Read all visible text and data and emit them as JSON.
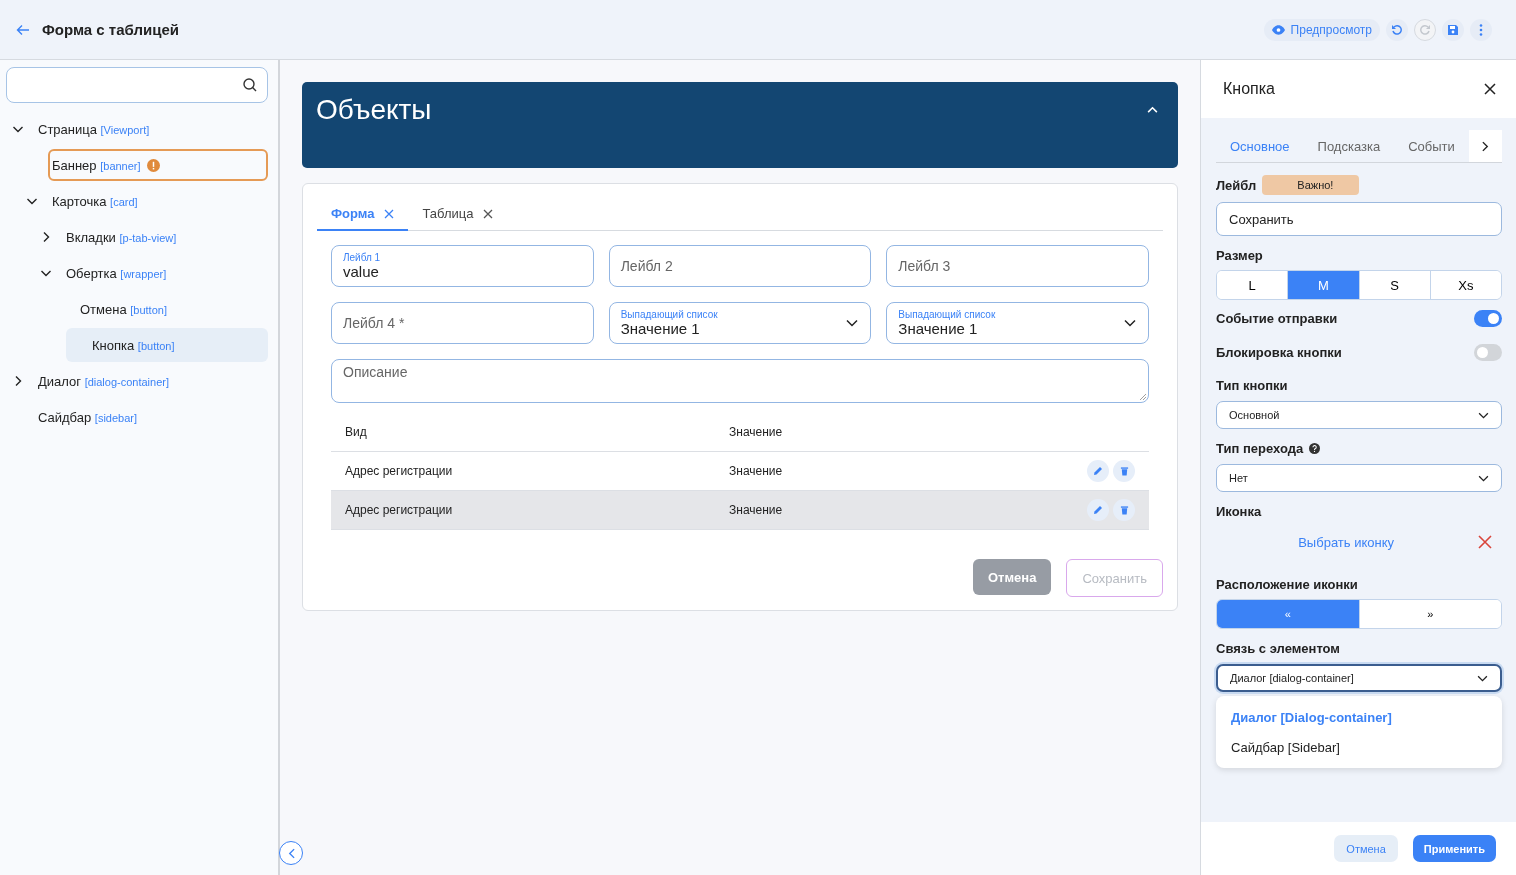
{
  "header": {
    "title": "Форма с таблицей",
    "preview": "Предпросмотр",
    "redo_disabled": true
  },
  "tree": [
    {
      "name": "Страница",
      "tag": "[Viewport]",
      "expanded": true,
      "selected": false,
      "children": [
        {
          "name": "Баннер",
          "tag": "[banner]",
          "selected": false,
          "warning": true
        },
        {
          "name": "Карточка",
          "tag": "[card]",
          "expanded": true,
          "selected": false,
          "children": [
            {
              "name": "Вкладки",
              "tag": "[p-tab-view]",
              "expanded": false,
              "selected": false
            },
            {
              "name": "Обертка",
              "tag": "[wrapper]",
              "expanded": true,
              "selected": false,
              "children": [
                {
                  "name": "Отмена",
                  "tag": "[button]",
                  "selected": false
                },
                {
                  "name": "Кнопка",
                  "tag": "[button]",
                  "selected": true
                }
              ]
            }
          ]
        }
      ]
    },
    {
      "name": "Диалог",
      "tag": "[dialog-container]",
      "expanded": false,
      "selected": false
    },
    {
      "name": "Сайдбар",
      "tag": "[sidebar]",
      "selected": false
    }
  ],
  "banner": {
    "title": "Объекты",
    "expanded": true
  },
  "card": {
    "tabs": [
      {
        "label": "Форма",
        "selected": true
      },
      {
        "label": "Таблица",
        "selected": false
      }
    ],
    "fields": [
      {
        "kind": "text",
        "label": "Лейбл 1",
        "value": "value"
      },
      {
        "kind": "text",
        "placeholder": "Лейбл 2"
      },
      {
        "kind": "text",
        "placeholder": "Лейбл 3"
      },
      {
        "kind": "text",
        "placeholder": "Лейбл 4 *"
      },
      {
        "kind": "select",
        "label": "Выпадающий список",
        "value": "Значение 1"
      },
      {
        "kind": "select",
        "label": "Выпадающий список",
        "value": "Значение 1"
      },
      {
        "kind": "textarea",
        "placeholder": "Описание"
      }
    ],
    "table": {
      "columns": [
        "Вид",
        "Значение"
      ],
      "rows": [
        {
          "cells": [
            "Адрес регистрации",
            "Значение"
          ],
          "hovered": false
        },
        {
          "cells": [
            "Адрес регистрации",
            "Значение"
          ],
          "hovered": true
        }
      ]
    },
    "cancel": "Отмена",
    "save": {
      "label": "Сохранить",
      "disabled": true
    }
  },
  "panel": {
    "title": "Кнопка",
    "tabs": [
      {
        "label": "Основное",
        "selected": true
      },
      {
        "label": "Подсказка",
        "selected": false
      },
      {
        "label": "Событи",
        "selected": false
      }
    ],
    "label": {
      "title": "Лейбл",
      "badge": "Важно!",
      "value": "Сохранить"
    },
    "size": {
      "title": "Размер",
      "options": [
        {
          "label": "L",
          "selected": false
        },
        {
          "label": "M",
          "selected": true
        },
        {
          "label": "S",
          "selected": false
        },
        {
          "label": "Xs",
          "selected": false
        }
      ]
    },
    "toggles": [
      {
        "label": "Событие отправки",
        "on": true
      },
      {
        "label": "Блокировка кнопки",
        "on": false
      }
    ],
    "button_type": {
      "title": "Тип кнопки",
      "value": "Основной"
    },
    "transition": {
      "title": "Тип перехода",
      "value": "Нет"
    },
    "icon": {
      "title": "Иконка",
      "link": "Выбрать иконку"
    },
    "icon_position": {
      "title": "Расположение иконки",
      "options": [
        {
          "label": "«",
          "selected": true
        },
        {
          "label": "»",
          "selected": false
        }
      ]
    },
    "link": {
      "title": "Связь с элементом",
      "value": "Диалог [dialog-container]",
      "open": true,
      "options": [
        {
          "label": "Диалог [Dialog-container]",
          "selected": true
        },
        {
          "label": "Сайдбар [Sidebar]",
          "selected": false
        }
      ]
    },
    "cancel": "Отмена",
    "apply": "Применить"
  }
}
